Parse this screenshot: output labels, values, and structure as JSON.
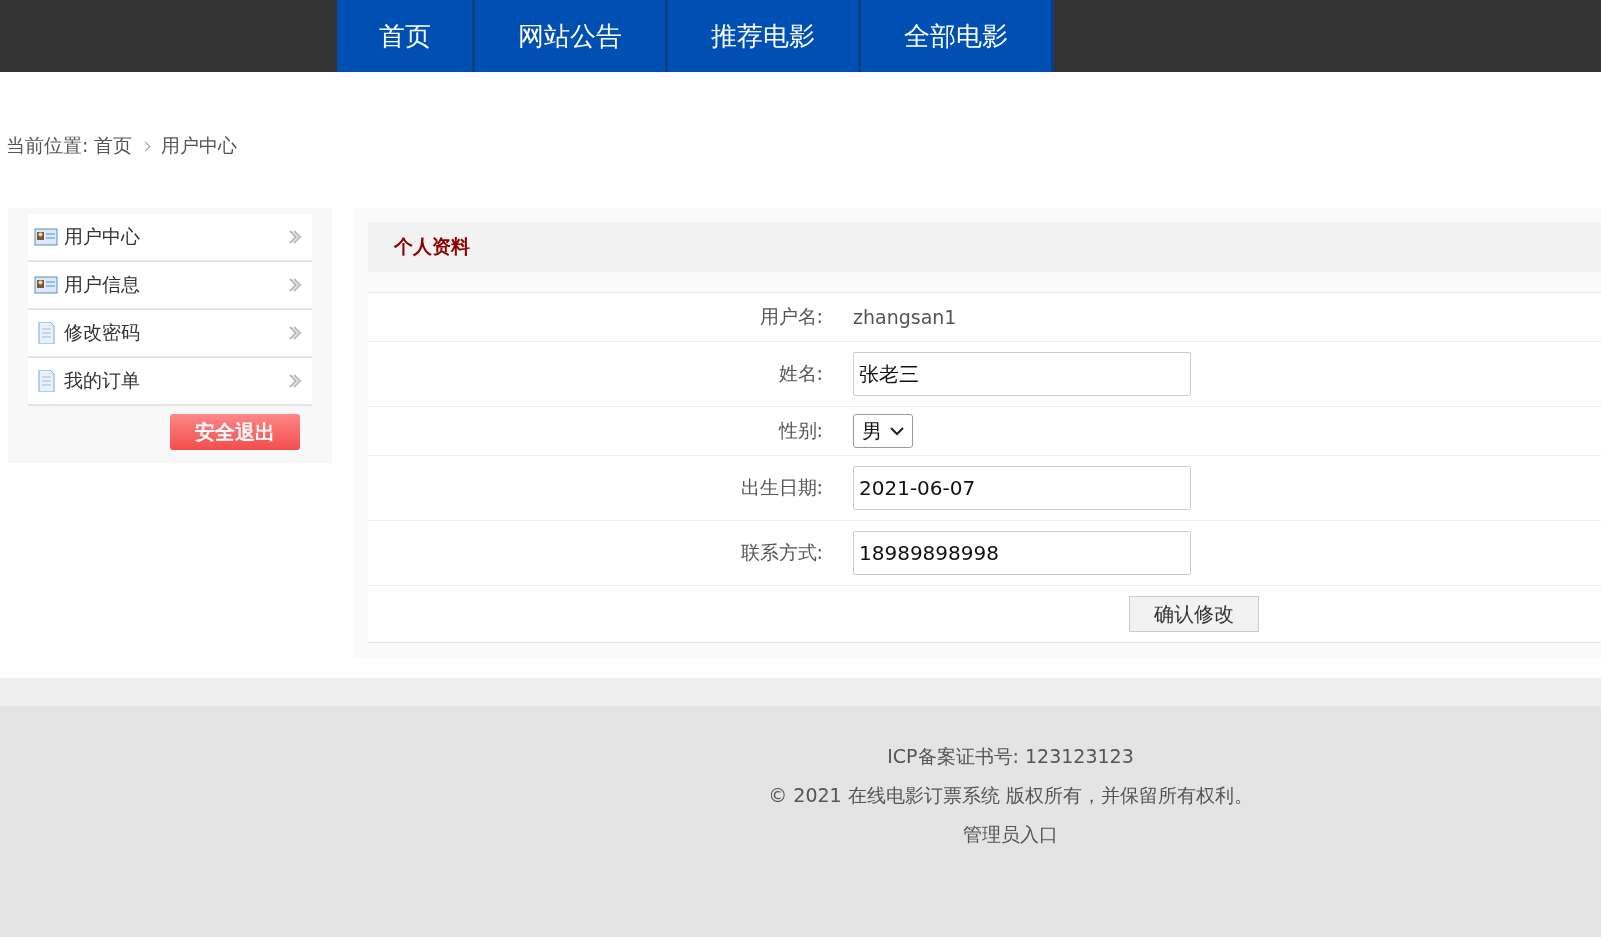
{
  "nav": {
    "tabs": [
      {
        "label": "首页",
        "selected": false
      },
      {
        "label": "网站公告",
        "selected": false
      },
      {
        "label": "推荐电影",
        "selected": false
      },
      {
        "label": "全部电影",
        "selected": false
      }
    ]
  },
  "breadcrumb": {
    "prefix": "当前位置:",
    "items": [
      "首页",
      "用户中心"
    ]
  },
  "sidebar": {
    "items": [
      {
        "label": "用户中心",
        "kind": "card"
      },
      {
        "label": "用户信息",
        "kind": "card"
      },
      {
        "label": "修改密码",
        "kind": "document"
      },
      {
        "label": "我的订单",
        "kind": "document"
      }
    ],
    "logout_button": "安全退出"
  },
  "profile": {
    "title": "个人资料",
    "fields": [
      {
        "kind": "text",
        "label": "用户名:",
        "value": "zhangsan1"
      },
      {
        "kind": "input",
        "label": "姓名:",
        "value": "张老三"
      },
      {
        "kind": "select",
        "label": "性别:",
        "value": "男"
      },
      {
        "kind": "input",
        "label": "出生日期:",
        "value": "2021-06-07"
      },
      {
        "kind": "input",
        "label": "联系方式:",
        "value": "18989898998"
      }
    ],
    "submit_button": "确认修改"
  },
  "footer": {
    "lines": [
      "ICP备案证书号: 123123123",
      "© 2021 在线电影订票系统 版权所有，并保留所有权利。",
      "管理员入口"
    ]
  }
}
